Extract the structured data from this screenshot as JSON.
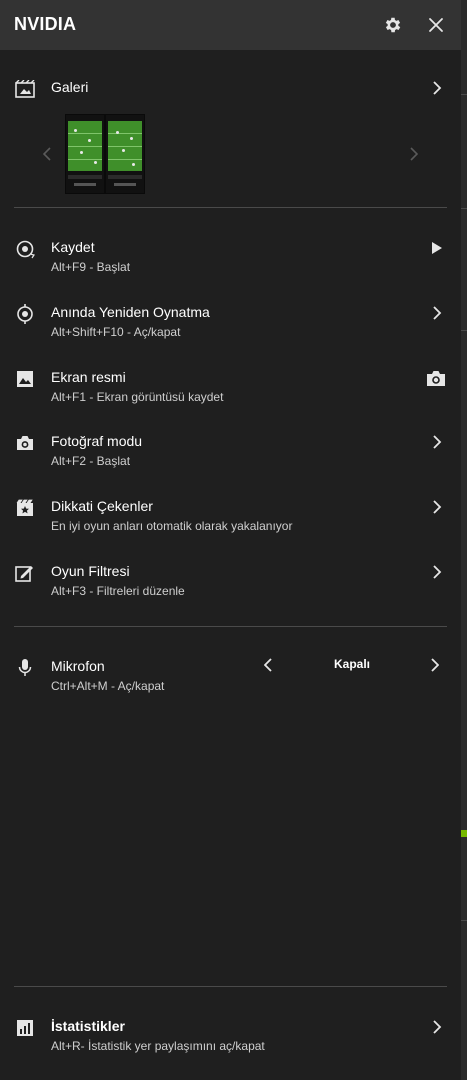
{
  "header": {
    "title": "NVIDIA"
  },
  "gallery": {
    "label": "Galeri"
  },
  "items": [
    {
      "label": "Kaydet",
      "shortcut": "Alt+F9 - Başlat"
    },
    {
      "label": "Anında Yeniden Oynatma",
      "shortcut": "Alt+Shift+F10 - Aç/kapat"
    },
    {
      "label": "Ekran resmi",
      "shortcut": "Alt+F1 - Ekran görüntüsü kaydet"
    },
    {
      "label": "Fotoğraf modu",
      "shortcut": "Alt+F2 - Başlat"
    },
    {
      "label": "Dikkati Çekenler",
      "shortcut": "En iyi oyun anları otomatik olarak yakalanıyor"
    },
    {
      "label": "Oyun Filtresi",
      "shortcut": "Alt+F3 - Filtreleri düzenle"
    }
  ],
  "microphone": {
    "label": "Mikrofon",
    "shortcut": "Ctrl+Alt+M - Aç/kapat",
    "value": "Kapalı"
  },
  "stats": {
    "label": "İstatistikler",
    "shortcut": "Alt+R- İstatistik yer paylaşımını aç/kapat"
  },
  "colors": {
    "background": "#1f1f1f",
    "header": "#333333",
    "accent": "#76b900",
    "text": "#ffffff",
    "subtext": "#cfcfcf"
  }
}
